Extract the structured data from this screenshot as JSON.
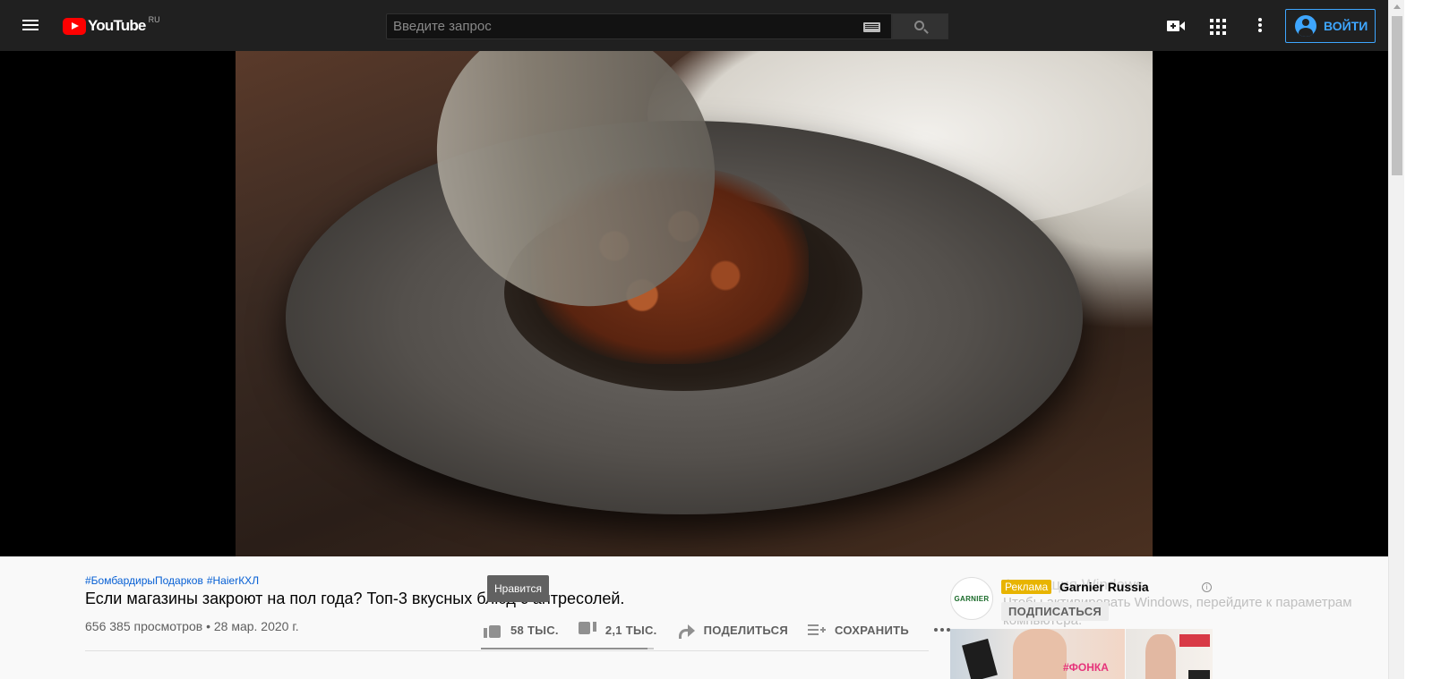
{
  "header": {
    "logo_text": "YouTube",
    "logo_country": "RU",
    "search_placeholder": "Введите запрос",
    "signin_label": "ВОЙТИ"
  },
  "video": {
    "hashtags": [
      "#БомбардирыПодарков",
      "#HaierКХЛ"
    ],
    "title": "Если магазины закроют на пол года? Топ-3 вкусных блюд с антресолей.",
    "views_line": "656 385 просмотров • 28 мар. 2020 г.",
    "like_ratio": 0.965
  },
  "actions": {
    "likes": "58 ТЫС.",
    "dislikes": "2,1 ТЫС.",
    "share": "ПОДЕЛИТЬСЯ",
    "save": "СОХРАНИТЬ"
  },
  "tooltip": "Нравится",
  "ad": {
    "logo_text": "GARNIER",
    "badge": "Реклама",
    "channel": "Garnier Russia",
    "subscribe": "ПОДПИСАТЬСЯ",
    "info_icon": "i",
    "thumb_text": "#ФОНКА"
  },
  "watermark": {
    "title": "Активация Windows",
    "text": "Чтобы активировать Windows, перейдите к параметрам компьютера."
  },
  "icons": {
    "menu": "hamburger-icon",
    "create": "video-camera-icon",
    "apps": "apps-grid-icon",
    "more": "more-vert-icon",
    "keyboard": "keyboard-icon",
    "search": "search-icon"
  },
  "colors": {
    "brand_red": "#ff0000",
    "accent_blue": "#3ea6ff",
    "link_blue": "#065fd4",
    "ad_yellow": "#e8b400"
  }
}
